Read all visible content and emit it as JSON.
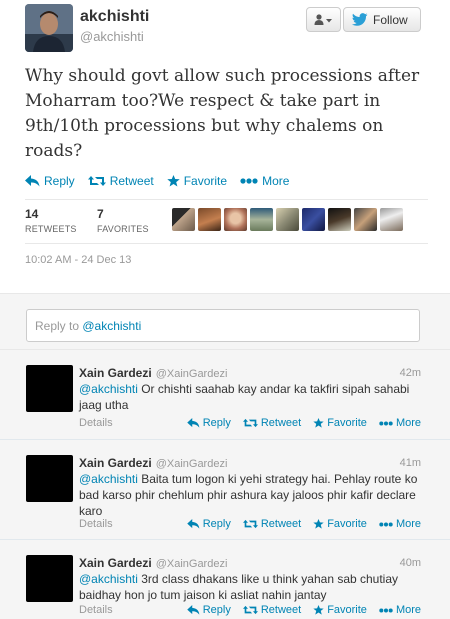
{
  "author": {
    "fullname": "akchishti",
    "screen_name": "@akchishti"
  },
  "follow_button": {
    "label": "Follow"
  },
  "tweet": {
    "text": "Why should govt allow such processions after Moharram too?We respect & take part in 9th/10th processions but why chalems on roads?",
    "timestamp": "10:02 AM - 24 Dec 13"
  },
  "actions": {
    "reply": "Reply",
    "retweet": "Retweet",
    "favorite": "Favorite",
    "more": "More"
  },
  "stats": {
    "retweets_count": "14",
    "retweets_label": "RETWEETS",
    "favorites_count": "7",
    "favorites_label": "FAVORITES"
  },
  "reply_box": {
    "prefix": "Reply to ",
    "mention": "@akchishti"
  },
  "replies": [
    {
      "fullname": "Xain Gardezi",
      "screen_name": "@XainGardezi",
      "time": "42m",
      "mention": "@akchishti",
      "text": " Or chishti saahab kay andar ka takfiri sipah sahabi jaag utha",
      "details": "Details"
    },
    {
      "fullname": "Xain Gardezi",
      "screen_name": "@XainGardezi",
      "time": "41m",
      "mention": "@akchishti",
      "text": " Baita tum logon ki yehi strategy hai. Pehlay route ko bad karso phir chehlum phir ashura kay jaloos phir kafir declare karo",
      "details": "Details"
    },
    {
      "fullname": "Xain Gardezi",
      "screen_name": "@XainGardezi",
      "time": "40m",
      "mention": "@akchishti",
      "text": " 3rd class dhakans like u think yahan sab chutiay baidhay hon jo tum jaison ki asliat nahin jantay",
      "details": "Details"
    }
  ],
  "colors": {
    "link": "#0084b4",
    "text": "#333333",
    "muted": "#999999",
    "stream_bg": "#f5f5f5"
  },
  "icons": [
    "user-dropdown-icon",
    "twitter-bird-icon",
    "reply-icon",
    "retweet-icon",
    "favorite-star-icon",
    "more-dots-icon"
  ]
}
